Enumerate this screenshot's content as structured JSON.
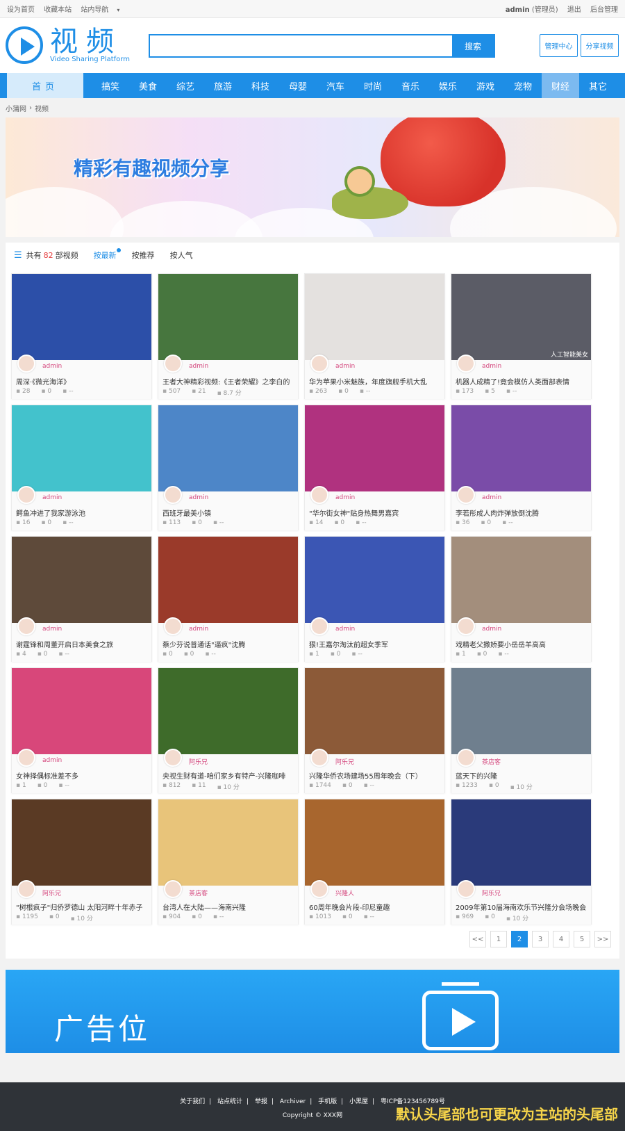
{
  "topbar": {
    "left": [
      "设为首页",
      "收藏本站",
      "站内导航"
    ],
    "user": "admin",
    "role": "(管理员)",
    "logout": "退出",
    "admin": "后台管理"
  },
  "header": {
    "logo_cn": "视频",
    "logo_en": "Video Sharing Platform",
    "search_value": "",
    "search_button": "搜索",
    "btn_manage": "管理中心",
    "btn_share": "分享视频"
  },
  "nav": [
    "首页",
    "搞笑",
    "美食",
    "综艺",
    "旅游",
    "科技",
    "母婴",
    "汽车",
    "时尚",
    "音乐",
    "娱乐",
    "游戏",
    "宠物",
    "财经",
    "其它"
  ],
  "breadcrumb": [
    "小蒲网",
    "视频"
  ],
  "banner": {
    "title": "精彩有趣视频分享"
  },
  "filter": {
    "total_prefix": "共有",
    "total": "82",
    "total_suffix": "部视频",
    "options": [
      "按最新",
      "按推荐",
      "按人气"
    ]
  },
  "videos": [
    {
      "author": "admin",
      "title": "周深·《微光海洋》",
      "views": "28",
      "comments": "0",
      "likes": "--",
      "bg": "#2c4fa8",
      "cap": ""
    },
    {
      "author": "admin",
      "title": "王者大神精彩视频:《王者荣耀》之李白的",
      "views": "507",
      "comments": "21",
      "likes": "8.7 分",
      "bg": "#47763e",
      "cap": ""
    },
    {
      "author": "admin",
      "title": "华为苹果小米魅族，年度旗舰手机大乱",
      "views": "263",
      "comments": "0",
      "likes": "--",
      "bg": "#e4e1df",
      "cap": ""
    },
    {
      "author": "admin",
      "title": "机器人成精了!竟会模仿人类面部表情",
      "views": "173",
      "comments": "5",
      "likes": "--",
      "bg": "#5b5c66",
      "cap": "人工智能美女"
    },
    {
      "author": "admin",
      "title": "鳄鱼冲进了我家游泳池",
      "views": "16",
      "comments": "0",
      "likes": "--",
      "bg": "#43c2cc",
      "cap": ""
    },
    {
      "author": "admin",
      "title": "西班牙最美小镇",
      "views": "113",
      "comments": "0",
      "likes": "--",
      "bg": "#4d86c8",
      "cap": ""
    },
    {
      "author": "admin",
      "title": "\"华尔街女神\"贴身热舞男嘉宾",
      "views": "14",
      "comments": "0",
      "likes": "--",
      "bg": "#b0327f",
      "cap": ""
    },
    {
      "author": "admin",
      "title": "李若彤成人肉炸弹放倒沈腾",
      "views": "36",
      "comments": "0",
      "likes": "--",
      "bg": "#7a4ca8",
      "cap": ""
    },
    {
      "author": "admin",
      "title": "谢霆锋和周董开启日本美食之旅",
      "views": "4",
      "comments": "0",
      "likes": "--",
      "bg": "#5e4a3a",
      "cap": ""
    },
    {
      "author": "admin",
      "title": "蔡少芬说普通话\"逼疯\"沈腾",
      "views": "0",
      "comments": "0",
      "likes": "--",
      "bg": "#9a3a2a",
      "cap": ""
    },
    {
      "author": "admin",
      "title": "狠!王嘉尔淘汰前超女季军",
      "views": "1",
      "comments": "0",
      "likes": "--",
      "bg": "#3b56b4",
      "cap": ""
    },
    {
      "author": "admin",
      "title": "戏精老父撒娇要小岳岳羊高高",
      "views": "1",
      "comments": "0",
      "likes": "--",
      "bg": "#a38e7c",
      "cap": ""
    },
    {
      "author": "admin",
      "title": "女神择偶标准差不多",
      "views": "1",
      "comments": "0",
      "likes": "--",
      "bg": "#d8477a",
      "cap": ""
    },
    {
      "author": "阿乐兄",
      "title": "央视生财有道-咱们家乡有特产-兴隆咖啡",
      "views": "812",
      "comments": "11",
      "likes": "10 分",
      "bg": "#3e6b2a",
      "cap": ""
    },
    {
      "author": "阿乐兄",
      "title": "兴隆华侨农场建场55周年晚会（下）",
      "views": "1744",
      "comments": "0",
      "likes": "--",
      "bg": "#8c5a38",
      "cap": ""
    },
    {
      "author": "茶店客",
      "title": "蓝天下的兴隆",
      "views": "1233",
      "comments": "0",
      "likes": "10 分",
      "bg": "#6f7f8e",
      "cap": ""
    },
    {
      "author": "阿乐兄",
      "title": "\"树根疯子\"归侨罗德山 太阳河畔十年赤子",
      "views": "1195",
      "comments": "0",
      "likes": "10 分",
      "bg": "#5a3a24",
      "cap": ""
    },
    {
      "author": "茶店客",
      "title": "台湾人在大陆——海南兴隆",
      "views": "904",
      "comments": "0",
      "likes": "--",
      "bg": "#e8c47a",
      "cap": ""
    },
    {
      "author": "兴隆人",
      "title": "60周年晚会片段-印尼童趣",
      "views": "1013",
      "comments": "0",
      "likes": "--",
      "bg": "#a8662e",
      "cap": ""
    },
    {
      "author": "阿乐兄",
      "title": "2009年第10届海南欢乐节兴隆分会场晚会",
      "views": "969",
      "comments": "0",
      "likes": "10 分",
      "bg": "#2a3a7a",
      "cap": ""
    }
  ],
  "pager": [
    "<<",
    "1",
    "2",
    "3",
    "4",
    "5",
    ">>"
  ],
  "pager_current": "2",
  "ad": {
    "text": "广告位"
  },
  "footer": {
    "links": [
      "关于我们",
      "站点统计",
      "举报",
      "Archiver",
      "手机版",
      "小黑屋",
      "粤ICP备123456789号"
    ],
    "copyright": "Copyright © XXX网",
    "note": "默认头尾部也可更改为主站的头尾部"
  },
  "colors": {
    "brand": "#1e8ee6",
    "accent_red": "#e43b3b",
    "author_pink": "#d4457c"
  }
}
